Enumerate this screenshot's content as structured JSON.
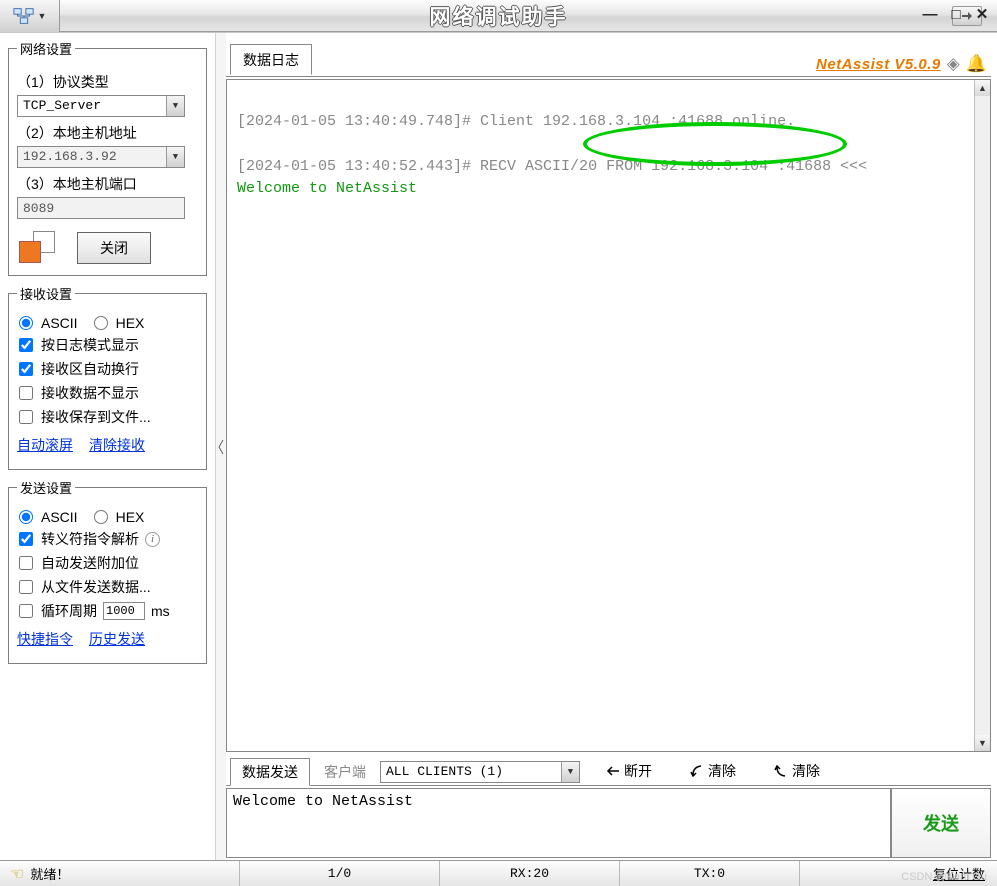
{
  "title": "网络调试助手",
  "brand": "NetAssist V5.0.9",
  "left": {
    "group_net": "网络设置",
    "proto_label": "（1）协议类型",
    "proto_value": "TCP_Server",
    "host_label": "（2）本地主机地址",
    "host_value": "192.168.3.92",
    "port_label": "（3）本地主机端口",
    "port_value": "8089",
    "close_btn": "关闭",
    "group_recv": "接收设置",
    "ascii": "ASCII",
    "hex": "HEX",
    "recv_log": "按日志模式显示",
    "recv_wrap": "接收区自动换行",
    "recv_hide": "接收数据不显示",
    "recv_save": "接收保存到文件...",
    "auto_scroll": "自动滚屏",
    "clear_recv": "清除接收",
    "group_send": "发送设置",
    "send_escape": "转义符指令解析",
    "send_append": "自动发送附加位",
    "send_fromfile": "从文件发送数据...",
    "send_loop_pre": "循环周期",
    "send_loop_value": "1000",
    "send_loop_suf": "ms",
    "quick_cmd": "快捷指令",
    "history_send": "历史发送"
  },
  "log_tab": "数据日志",
  "log_lines": {
    "l1": "[2024-01-05 13:40:49.748]# Client 192.168.3.104 :41688 online.",
    "l2a": "[2024-01-05 13:40:52.443]# RECV ASCII/2",
    "l2b": "0 FROM 192.168.3.104 :41688",
    "l2c": " <<<",
    "l3": "Welcome to NetAssist"
  },
  "send": {
    "tab": "数据发送",
    "client_label": "客户端",
    "target": "ALL CLIENTS (1)",
    "disconnect": "断开",
    "clear1": "清除",
    "clear2": "清除",
    "text": "Welcome to NetAssist",
    "button": "发送"
  },
  "status": {
    "ready": "就绪！",
    "io": "1/0",
    "rx": "RX:20",
    "tx": "TX:0",
    "reset": "复位计数"
  },
  "watermark": "CSDN @Kent Gu"
}
